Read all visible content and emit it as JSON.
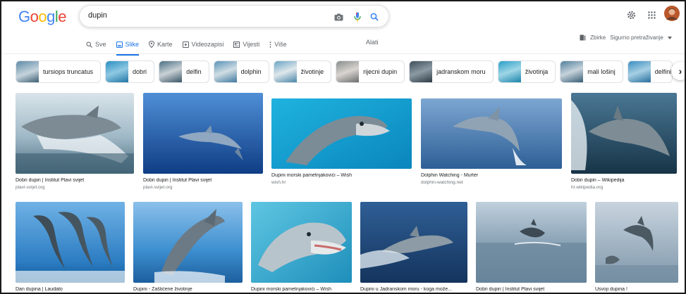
{
  "search": {
    "query": "dupin"
  },
  "nav": {
    "tabs": [
      {
        "label": "Sve",
        "icon": "search-icon",
        "active": false
      },
      {
        "label": "Slike",
        "icon": "image-icon",
        "active": true
      },
      {
        "label": "Karte",
        "icon": "map-pin-icon",
        "active": false
      },
      {
        "label": "Videozapisi",
        "icon": "video-icon",
        "active": false
      },
      {
        "label": "Vijesti",
        "icon": "news-icon",
        "active": false
      },
      {
        "label": "Više",
        "icon": "more-vert-icon",
        "active": false
      }
    ],
    "tools": "Alati",
    "collections": "Zbirke",
    "safe_search": "Sigurno pretraživanje"
  },
  "chips": [
    "tursiops truncatus",
    "dobri",
    "delfin",
    "dolphin",
    "životinje",
    "rijecni dupin",
    "jadranskom moru",
    "životinja",
    "mali lošinj",
    "delfini"
  ],
  "results": [
    {
      "title": "Dobri dupin | Institut Plavi svijet",
      "source": "plavi-svijet.org"
    },
    {
      "title": "Dobri dupin | Institut Plavi svijet",
      "source": "plavi-svijet.org"
    },
    {
      "title": "Dupini morski pametnjakovići – Wish",
      "source": "wish.hr"
    },
    {
      "title": "Dolphin Watching - Murter",
      "source": "dolphin-watching.net"
    },
    {
      "title": "Dobri dupin – Wikipedija",
      "source": "hr.wikipedia.org"
    },
    {
      "title": "Dan dupina | Laudato",
      "source": ""
    },
    {
      "title": "Dupini - Zaštićene životinje",
      "source": ""
    },
    {
      "title": "Dupini morski pametnjakovići – Wish",
      "source": ""
    },
    {
      "title": "Dupini u Jadranskom moru - koga može...",
      "source": ""
    },
    {
      "title": "Dobri dupin | Institut Plavi svijet",
      "source": ""
    },
    {
      "title": "Usvoji dupina !",
      "source": ""
    }
  ],
  "colors": {
    "accent": "#1a73e8",
    "google_blue": "#4285f4",
    "google_red": "#ea4335",
    "google_yellow": "#fbbc05",
    "google_green": "#34a853"
  }
}
